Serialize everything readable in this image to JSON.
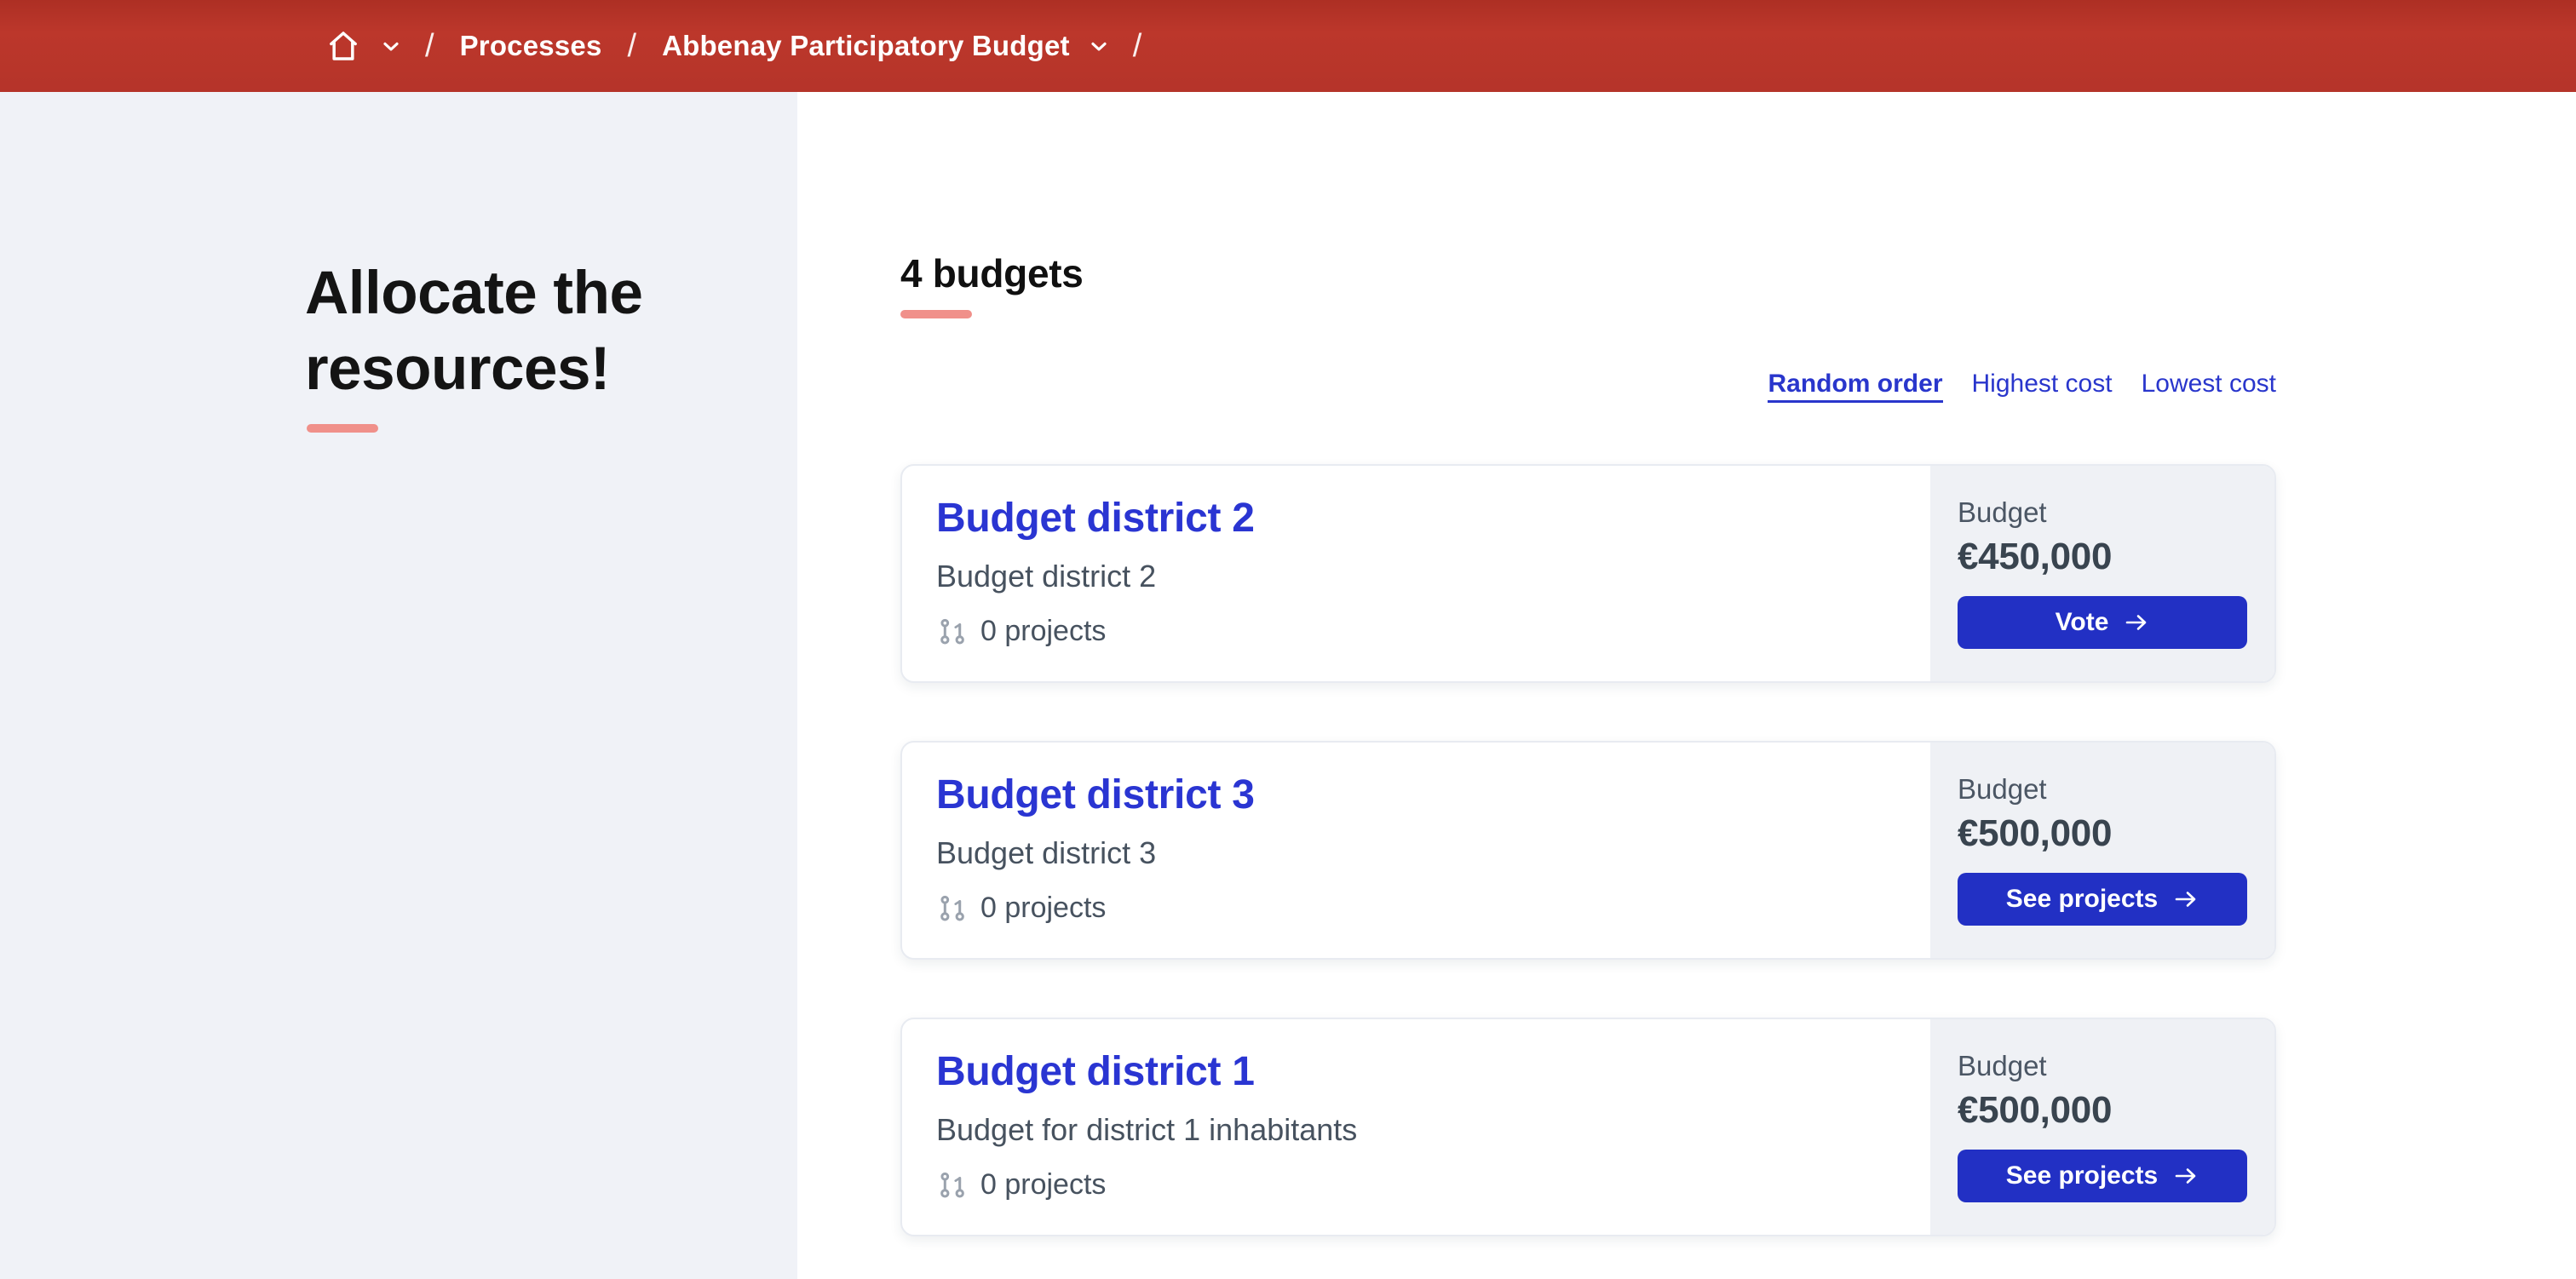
{
  "theme": {
    "header_bg": "#b5342a",
    "accent_red": "#f0908a",
    "link_blue": "#2a35d2",
    "button_blue": "#2230c4",
    "sidebar_bg": "#f0f2f7",
    "panel_bg": "#eff1f5",
    "text_slate": "#47525f"
  },
  "breadcrumb": {
    "separator": "/",
    "items": [
      "Processes",
      "Abbenay Participatory Budget"
    ]
  },
  "sidebar": {
    "title": "Allocate the resources!"
  },
  "main": {
    "heading": "4 budgets",
    "sort_options": [
      {
        "label": "Random order",
        "active": true
      },
      {
        "label": "Highest cost",
        "active": false
      },
      {
        "label": "Lowest cost",
        "active": false
      }
    ],
    "budgets": [
      {
        "title": "Budget district 2",
        "description": "Budget district 2",
        "projects_count": "0 projects",
        "budget_label": "Budget",
        "amount": "€450,000",
        "action": "Vote"
      },
      {
        "title": "Budget district 3",
        "description": "Budget district 3",
        "projects_count": "0 projects",
        "budget_label": "Budget",
        "amount": "€500,000",
        "action": "See projects"
      },
      {
        "title": "Budget district 1",
        "description": "Budget for district 1 inhabitants",
        "projects_count": "0 projects",
        "budget_label": "Budget",
        "amount": "€500,000",
        "action": "See projects"
      }
    ]
  }
}
